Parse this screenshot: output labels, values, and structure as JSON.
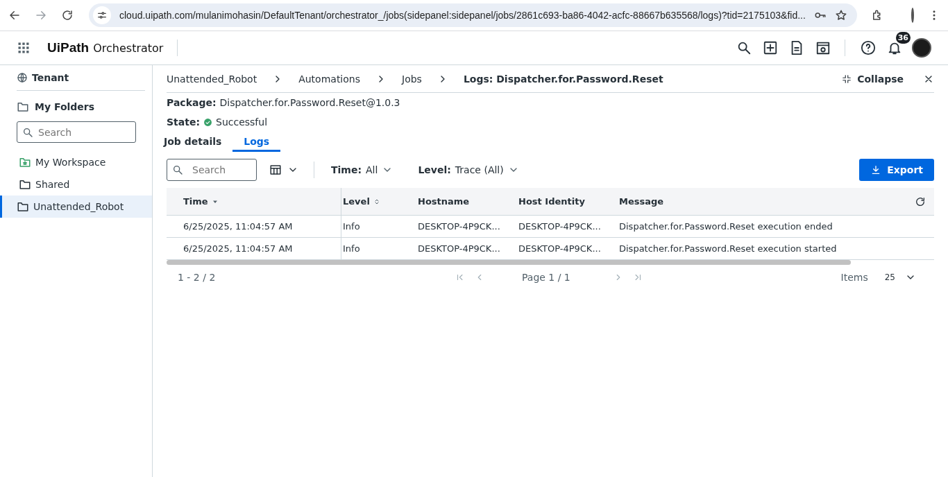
{
  "browser": {
    "url": "cloud.uipath.com/mulanimohasin/DefaultTenant/orchestrator_/jobs(sidepanel:sidepanel/jobs/2861c693-ba86-4042-acfc-88667b635568/logs)?tid=2175103&fid..."
  },
  "header": {
    "logo": "UiPath",
    "product": "Orchestrator",
    "notification_count": "36"
  },
  "sidebar": {
    "tenant": "Tenant",
    "section": "My Folders",
    "search_placeholder": "Search",
    "folders": [
      {
        "label": "My Workspace",
        "kind": "workspace",
        "selected": false
      },
      {
        "label": "Shared",
        "kind": "folder",
        "selected": false
      },
      {
        "label": "Unattended_Robot",
        "kind": "folder",
        "selected": true
      }
    ]
  },
  "breadcrumb": {
    "items": [
      "Unattended_Robot",
      "Automations",
      "Jobs"
    ],
    "current": "Logs: Dispatcher.for.Password.Reset",
    "collapse": "Collapse"
  },
  "details": [
    {
      "label": "Package:",
      "value": "Dispatcher.for.Password.Reset@1.0.3",
      "kind": "text"
    },
    {
      "label": "State:",
      "value": "Successful",
      "kind": "status"
    }
  ],
  "tabs": [
    {
      "label": "Job details",
      "selected": false
    },
    {
      "label": "Logs",
      "selected": true
    }
  ],
  "toolbar": {
    "search_placeholder": "Search",
    "filters": [
      {
        "label": "Time:",
        "value": "All"
      },
      {
        "label": "Level:",
        "value": "Trace (All)"
      }
    ],
    "export": "Export"
  },
  "table": {
    "columns": [
      {
        "label": "Time",
        "kind": "sorted"
      },
      {
        "label": "Level",
        "kind": "sortable"
      },
      {
        "label": "Hostname",
        "kind": "plain"
      },
      {
        "label": "Host Identity",
        "kind": "plain"
      },
      {
        "label": "Message",
        "kind": "plain"
      }
    ],
    "rows": [
      [
        "6/25/2025, 11:04:57 AM",
        "Info",
        "DESKTOP-4P9CK...",
        "DESKTOP-4P9CK...",
        "Dispatcher.for.Password.Reset execution ended"
      ],
      [
        "6/25/2025, 11:04:57 AM",
        "Info",
        "DESKTOP-4P9CK...",
        "DESKTOP-4P9CK...",
        "Dispatcher.for.Password.Reset execution started"
      ]
    ]
  },
  "pager": {
    "range": "1 - 2 / 2",
    "page": "Page 1 / 1",
    "items_label": "Items",
    "page_size": "25"
  }
}
